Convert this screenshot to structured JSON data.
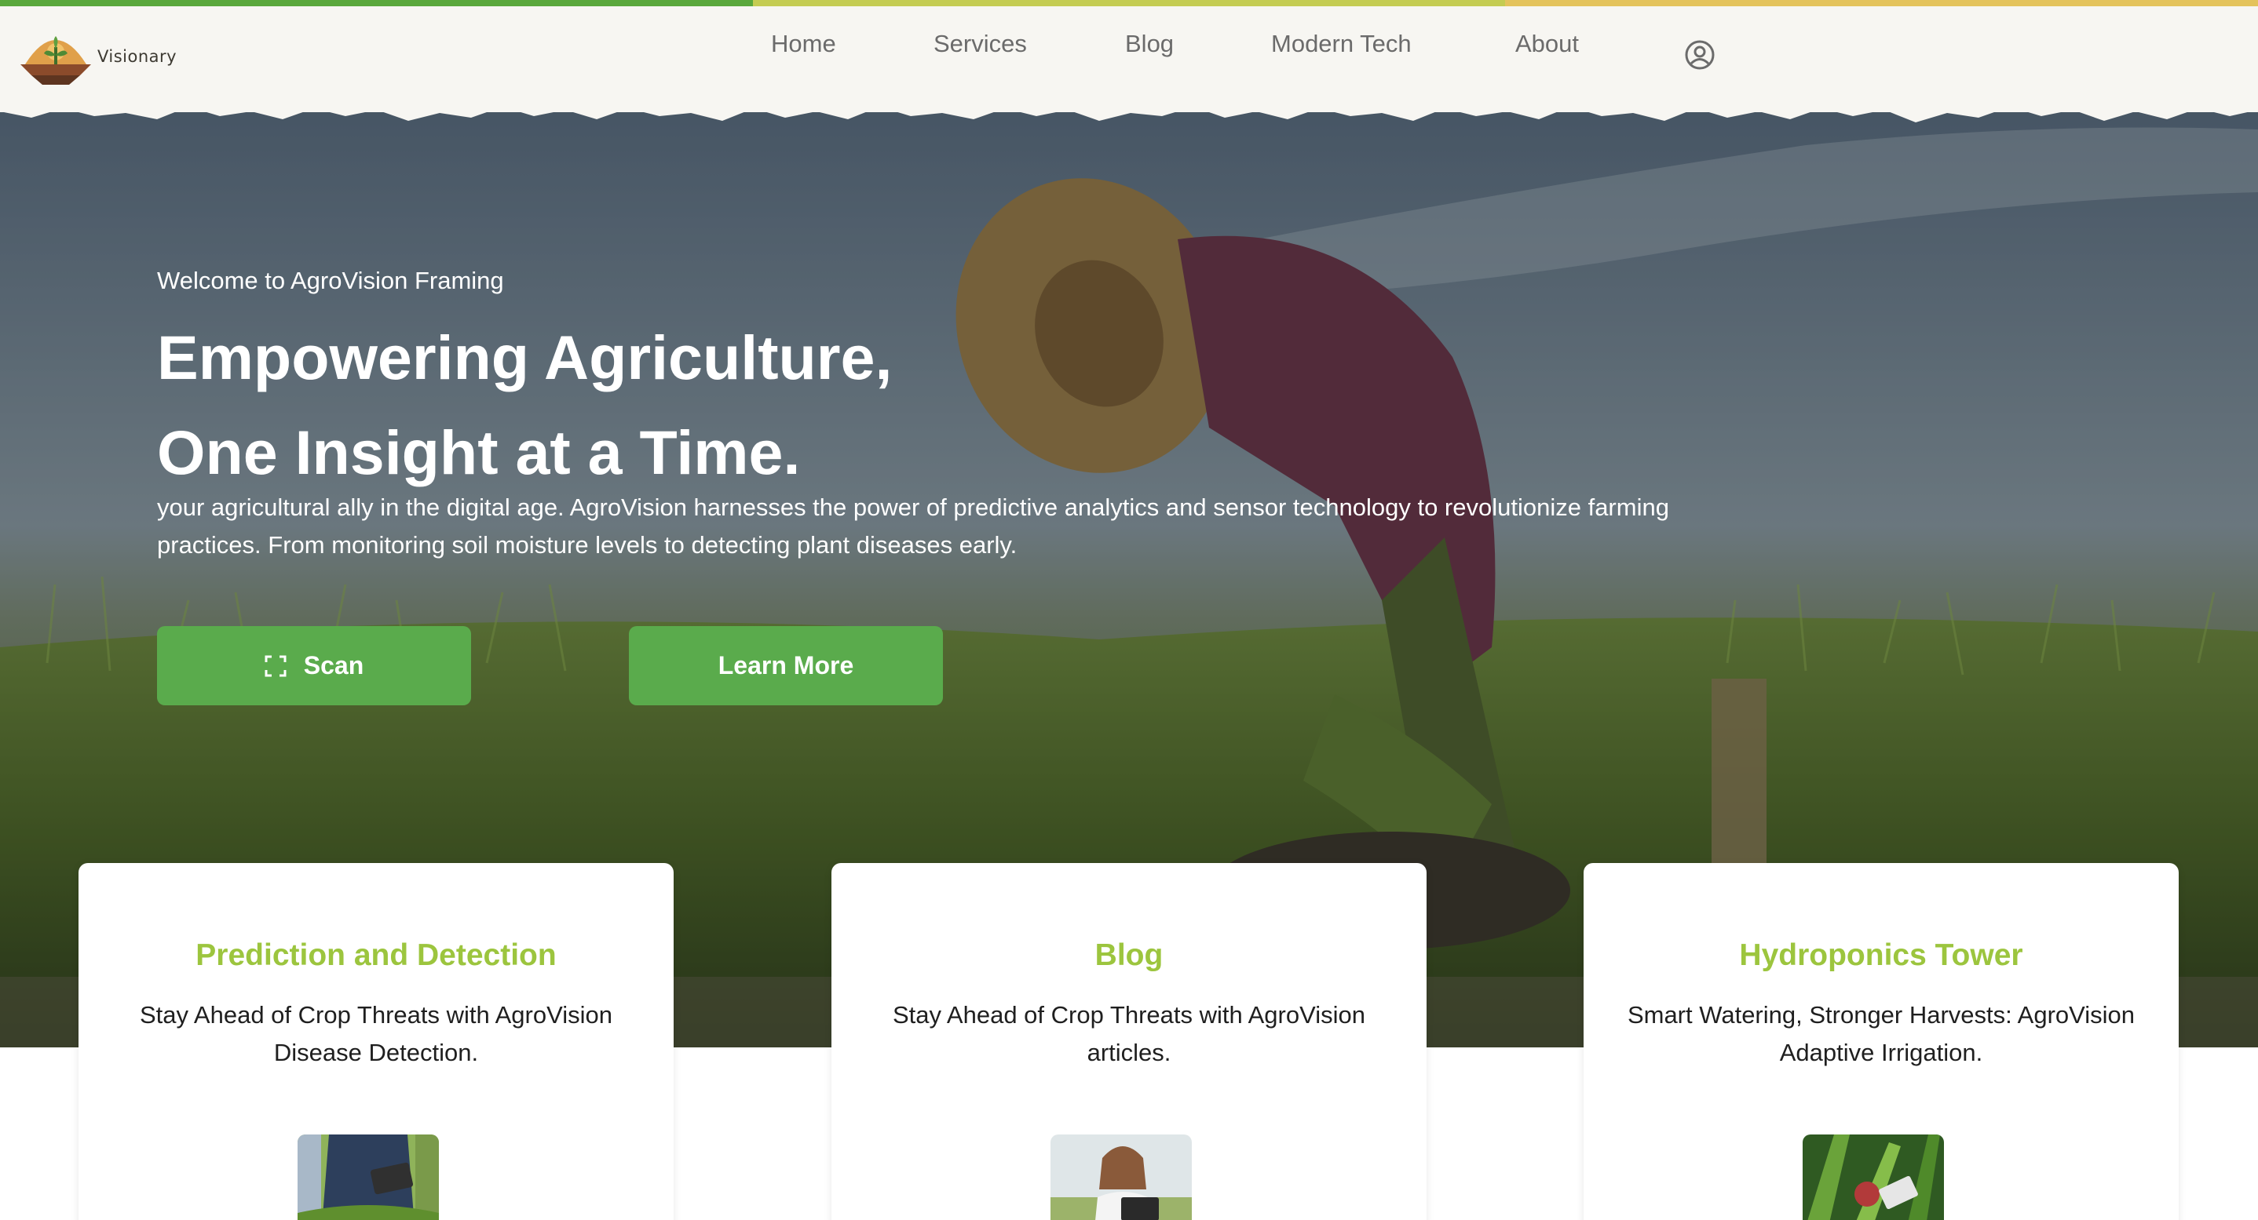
{
  "colors": {
    "stripe": [
      "#5aa83c",
      "#c4cc52",
      "#e4c35c"
    ],
    "nav_bg": "#f7f6f2",
    "accent_green": "#5aab4c",
    "card_title": "#9cc53e"
  },
  "brand": {
    "name": "Visionary",
    "logo_icon": "farm-logo-icon"
  },
  "nav": {
    "items": [
      {
        "label": "Home"
      },
      {
        "label": "Services"
      },
      {
        "label": "Blog"
      },
      {
        "label": "Modern Tech"
      },
      {
        "label": "About"
      }
    ],
    "account_icon": "user-circle-icon"
  },
  "hero": {
    "welcome": "Welcome to AgroVision Framing",
    "headline_line1": "Empowering Agriculture,",
    "headline_line2": "One Insight at a Time.",
    "description": "your agricultural ally in the digital age. AgroVision harnesses the power of predictive analytics and sensor technology to revolutionize farming practices. From monitoring soil moisture levels to detecting plant diseases early.",
    "scan_label": "Scan",
    "scan_icon": "scan-frame-icon",
    "learn_more_label": "Learn More"
  },
  "cards": [
    {
      "title": "Prediction and Detection",
      "text": "Stay Ahead of Crop Threats with AgroVision Disease Detection."
    },
    {
      "title": "Blog",
      "text": "Stay Ahead of Crop Threats with AgroVision articles."
    },
    {
      "title": "Hydroponics Tower",
      "text": "Smart Watering, Stronger Harvests: AgroVision Adaptive Irrigation."
    }
  ]
}
